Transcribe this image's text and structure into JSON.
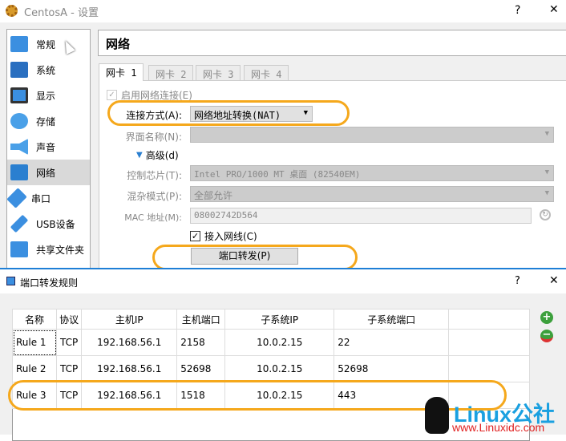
{
  "window": {
    "title": "CentosA - 设置",
    "help": "?",
    "close": "✕"
  },
  "sidebar": {
    "items": [
      {
        "label": "常规",
        "color": "#3b8fe0"
      },
      {
        "label": "系统",
        "color": "#2a6fc0"
      },
      {
        "label": "显示",
        "color": "#3b8fe0"
      },
      {
        "label": "存储",
        "color": "#4aa0e8"
      },
      {
        "label": "声音",
        "color": "#4aa0e8"
      },
      {
        "label": "网络",
        "color": "#2a7fd0"
      },
      {
        "label": "串口",
        "color": "#3b8fe0"
      },
      {
        "label": "USB设备",
        "color": "#3b8fe0"
      },
      {
        "label": "共享文件夹",
        "color": "#3b8fe0"
      }
    ]
  },
  "header": {
    "title": "网络"
  },
  "tabs": [
    "网卡 1",
    "网卡 2",
    "网卡 3",
    "网卡 4"
  ],
  "form": {
    "enable_label": "启用网络连接(E)",
    "attach_label": "连接方式(A):",
    "attach_value": "网络地址转换(NAT)",
    "iface_label": "界面名称(N):",
    "advanced_label": "高级(d)",
    "chip_label": "控制芯片(T):",
    "chip_value": "Intel PRO/1000 MT 桌面 (82540EM)",
    "promisc_label": "混杂模式(P):",
    "promisc_value": "全部允许",
    "mac_label": "MAC 地址(M):",
    "mac_value": "08002742D564",
    "cable_label": "接入网线(C)",
    "port_forward_button": "端口转发(P)"
  },
  "dialog": {
    "title": "端口转发规则",
    "help": "?",
    "close": "✕",
    "columns": [
      "名称",
      "协议",
      "主机IP",
      "主机端口",
      "子系统IP",
      "子系统端口"
    ],
    "rows": [
      [
        "Rule 1",
        "TCP",
        "192.168.56.1",
        "2158",
        "10.0.2.15",
        "22"
      ],
      [
        "Rule 2",
        "TCP",
        "192.168.56.1",
        "52698",
        "10.0.2.15",
        "52698"
      ],
      [
        "Rule 3",
        "TCP",
        "192.168.56.1",
        "1518",
        "10.0.2.15",
        "443"
      ]
    ]
  },
  "watermark": {
    "brand": "Linux公社",
    "url": "www.Linuxidc.com"
  },
  "accent": "#f5a81c"
}
